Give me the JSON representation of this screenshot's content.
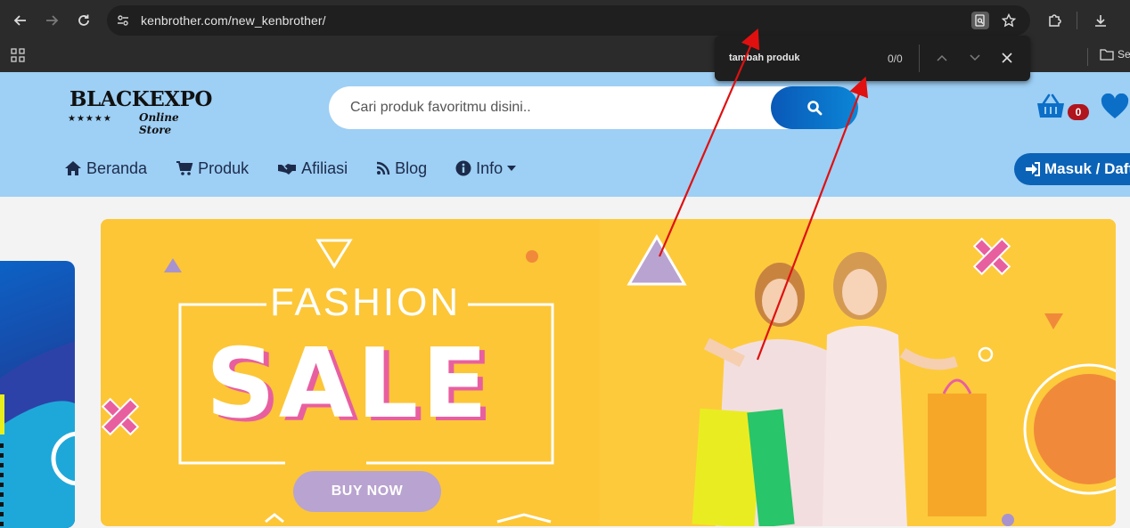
{
  "browser": {
    "url": "kenbrother.com/new_kenbrother/",
    "bookmark_partial": "Se",
    "find": {
      "query": "tambah produk",
      "count": "0/0"
    }
  },
  "site": {
    "logo_main": "BLACKEXPO",
    "logo_stars": "★★★★★",
    "logo_sub": "Online Store",
    "search_placeholder": "Cari produk favoritmu disini..",
    "cart_count": "0",
    "menu": [
      {
        "label": "Beranda",
        "icon": "home-icon"
      },
      {
        "label": "Produk",
        "icon": "cart-icon"
      },
      {
        "label": "Afiliasi",
        "icon": "handshake-icon"
      },
      {
        "label": "Blog",
        "icon": "rss-icon"
      },
      {
        "label": "Info",
        "icon": "info-icon"
      }
    ],
    "login_label": "Masuk / Daft"
  },
  "banner": {
    "line1": "FASHION",
    "line2": "SALE",
    "button": "BUY NOW"
  },
  "colors": {
    "header_bg": "#9ecff5",
    "banner_bg": "#fcc637",
    "accent_blue": "#0b63b8",
    "pink": "#e85fa0",
    "lavender": "#b9a3d0",
    "annotation_red": "#e01010"
  }
}
